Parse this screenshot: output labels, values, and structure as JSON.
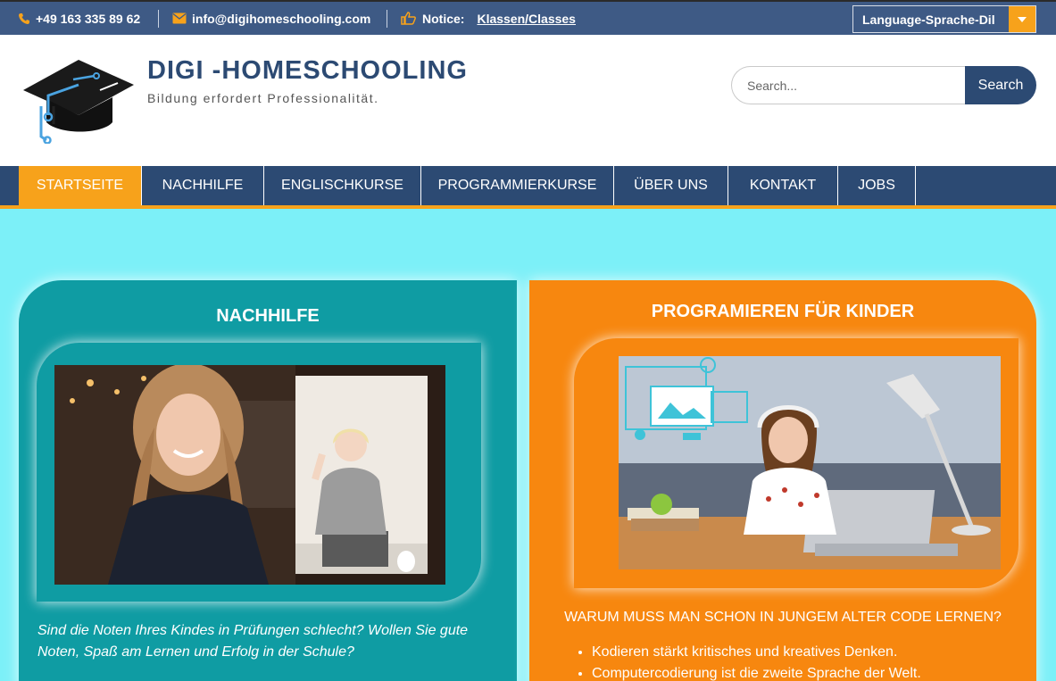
{
  "topbar": {
    "phone": "+49 163 335 89 62",
    "email": "info@digihomeschooling.com",
    "notice_label": "Notice:",
    "notice_link": "Klassen/Classes",
    "language_select": "Language-Sprache-Dil"
  },
  "header": {
    "site_title": "DIGI -HOMESCHOOLING",
    "tagline": "Bildung erfordert Professionalität.",
    "search_placeholder": "Search...",
    "search_button": "Search"
  },
  "nav": {
    "items": [
      {
        "label": "STARTSEITE",
        "active": true
      },
      {
        "label": "NACHHILFE"
      },
      {
        "label": "ENGLISCHKURSE"
      },
      {
        "label": "PROGRAMMIERKURSE"
      },
      {
        "label": "ÜBER UNS"
      },
      {
        "label": "KONTAKT"
      },
      {
        "label": "JOBS"
      }
    ]
  },
  "cards": {
    "left": {
      "title": "NACHHILFE",
      "text": "Sind die Noten Ihres Kindes in Prüfungen schlecht? Wollen Sie gute Noten, Spaß am Lernen und Erfolg in der Schule?"
    },
    "right": {
      "title": "PROGRAMIEREN FÜR KINDER",
      "heading": "WARUM MUSS MAN SCHON IN JUNGEM ALTER CODE LERNEN?",
      "bullets": [
        "Kodieren stärkt kritisches und kreatives Denken.",
        "Computercodierung ist die zweite Sprache der Welt."
      ]
    }
  },
  "colors": {
    "topbar": "#3e5a85",
    "nav": "#2c4a73",
    "accent": "#f7a21b",
    "page_bg": "#7cf0f8",
    "card_teal": "#0f9ca3",
    "card_orange": "#f7870f"
  },
  "icons": [
    "phone-icon",
    "envelope-icon",
    "thumbs-up-icon",
    "chevron-down-icon",
    "graduation-cap-logo"
  ]
}
